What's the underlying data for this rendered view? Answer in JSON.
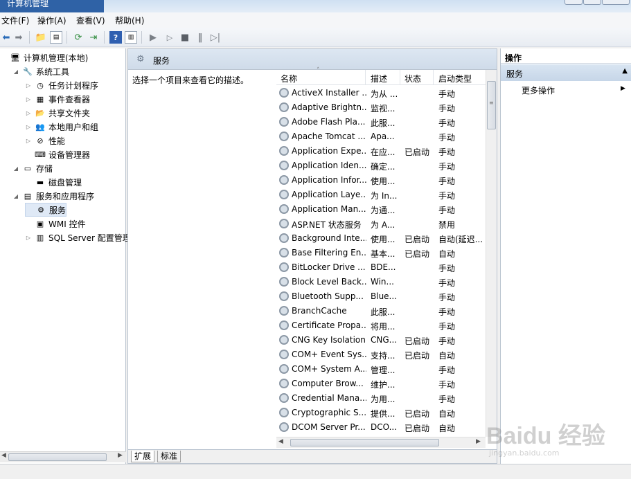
{
  "window": {
    "title": "计算机管理"
  },
  "menu": [
    "文件(F)",
    "操作(A)",
    "查看(V)",
    "帮助(H)"
  ],
  "tree": [
    {
      "label": "计算机管理(本地)",
      "level": 0,
      "expander": "",
      "icon": "computer-management-icon"
    },
    {
      "label": "系统工具",
      "level": 1,
      "expander": "◢",
      "icon": "system-tools-icon"
    },
    {
      "label": "任务计划程序",
      "level": 2,
      "expander": "▷",
      "icon": "task-scheduler-icon"
    },
    {
      "label": "事件查看器",
      "level": 2,
      "expander": "▷",
      "icon": "event-viewer-icon"
    },
    {
      "label": "共享文件夹",
      "level": 2,
      "expander": "▷",
      "icon": "shared-folders-icon"
    },
    {
      "label": "本地用户和组",
      "level": 2,
      "expander": "▷",
      "icon": "local-users-icon"
    },
    {
      "label": "性能",
      "level": 2,
      "expander": "▷",
      "icon": "performance-icon"
    },
    {
      "label": "设备管理器",
      "level": 2,
      "expander": "",
      "icon": "device-manager-icon"
    },
    {
      "label": "存储",
      "level": 1,
      "expander": "◢",
      "icon": "storage-icon"
    },
    {
      "label": "磁盘管理",
      "level": 2,
      "expander": "",
      "icon": "disk-management-icon"
    },
    {
      "label": "服务和应用程序",
      "level": 1,
      "expander": "◢",
      "icon": "services-apps-icon"
    },
    {
      "label": "服务",
      "level": 2,
      "expander": "",
      "icon": "services-icon",
      "selected": true
    },
    {
      "label": "WMI 控件",
      "level": 2,
      "expander": "",
      "icon": "wmi-icon"
    },
    {
      "label": "SQL Server 配置管理器",
      "level": 2,
      "expander": "▷",
      "icon": "sql-server-icon"
    }
  ],
  "middle": {
    "header": "服务",
    "description": "选择一个项目来查看它的描述。",
    "columns": [
      "名称",
      "描述",
      "状态",
      "启动类型"
    ],
    "rows": [
      {
        "name": "ActiveX Installer ...",
        "desc": "为从 ...",
        "status": "",
        "startup": "手动"
      },
      {
        "name": "Adaptive Brightn...",
        "desc": "监视...",
        "status": "",
        "startup": "手动"
      },
      {
        "name": "Adobe Flash Pla...",
        "desc": "此服...",
        "status": "",
        "startup": "手动"
      },
      {
        "name": "Apache Tomcat ...",
        "desc": "Apa...",
        "status": "",
        "startup": "手动"
      },
      {
        "name": "Application Expe...",
        "desc": "在应...",
        "status": "已启动",
        "startup": "手动"
      },
      {
        "name": "Application Iden...",
        "desc": "确定...",
        "status": "",
        "startup": "手动"
      },
      {
        "name": "Application Infor...",
        "desc": "使用...",
        "status": "",
        "startup": "手动"
      },
      {
        "name": "Application Laye...",
        "desc": "为 In...",
        "status": "",
        "startup": "手动"
      },
      {
        "name": "Application Man...",
        "desc": "为通...",
        "status": "",
        "startup": "手动"
      },
      {
        "name": "ASP.NET 状态服务",
        "desc": "为 A...",
        "status": "",
        "startup": "禁用"
      },
      {
        "name": "Background Inte...",
        "desc": "使用...",
        "status": "已启动",
        "startup": "自动(延迟..."
      },
      {
        "name": "Base Filtering En...",
        "desc": "基本...",
        "status": "已启动",
        "startup": "自动"
      },
      {
        "name": "BitLocker Drive ...",
        "desc": "BDE...",
        "status": "",
        "startup": "手动"
      },
      {
        "name": "Block Level Back...",
        "desc": "Win...",
        "status": "",
        "startup": "手动"
      },
      {
        "name": "Bluetooth Supp...",
        "desc": "Blue...",
        "status": "",
        "startup": "手动"
      },
      {
        "name": "BranchCache",
        "desc": "此服...",
        "status": "",
        "startup": "手动"
      },
      {
        "name": "Certificate Propa...",
        "desc": "将用...",
        "status": "",
        "startup": "手动"
      },
      {
        "name": "CNG Key Isolation",
        "desc": "CNG...",
        "status": "已启动",
        "startup": "手动"
      },
      {
        "name": "COM+ Event Sys...",
        "desc": "支持...",
        "status": "已启动",
        "startup": "自动"
      },
      {
        "name": "COM+ System A...",
        "desc": "管理...",
        "status": "",
        "startup": "手动"
      },
      {
        "name": "Computer Brow...",
        "desc": "维护...",
        "status": "",
        "startup": "手动"
      },
      {
        "name": "Credential Mana...",
        "desc": "为用...",
        "status": "",
        "startup": "手动"
      },
      {
        "name": "Cryptographic S...",
        "desc": "提供...",
        "status": "已启动",
        "startup": "自动"
      },
      {
        "name": "DCOM Server Pr...",
        "desc": "DCO...",
        "status": "已启动",
        "startup": "自动"
      }
    ],
    "tabs": [
      "扩展",
      "标准"
    ]
  },
  "actions": {
    "title": "操作",
    "section": "服务",
    "more": "更多操作"
  },
  "watermark": {
    "brand": "Baidu 经验",
    "url": "jingyan.baidu.com"
  },
  "colors": {
    "header_bg": "#cfdbe9",
    "selection": "#dfe9f6",
    "action_section": "#c6d6e8"
  }
}
